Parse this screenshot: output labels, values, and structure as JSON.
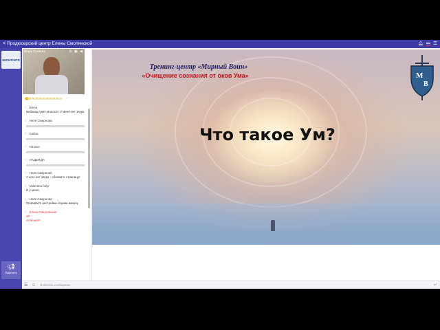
{
  "titlebar": {
    "title": "Продюсерский центр Елены Смолянской"
  },
  "sidebar": {
    "logo_text": "ВКОНТАКТЕ",
    "share_label": "Поделить"
  },
  "video": {
    "presenter_name": "Игорь Ружанко",
    "controls": "⊡ ▣ ◀"
  },
  "chat": {
    "emoji_line": "😊!!!!!!!!!!!!!!!!!!!!!!!!!!!!!!!!!!!!!!!",
    "messages": [
      {
        "author": "Elena",
        "text": "Вебинар уже начался? У меня нет звука",
        "bar": false
      },
      {
        "author": "Неля Смирнова",
        "text": "",
        "bar": true
      },
      {
        "author": "Galina",
        "text": "",
        "bar": true
      },
      {
        "author": "Наталя",
        "text": "",
        "bar": true
      },
      {
        "author": "НАДЕЖДА",
        "text": "",
        "bar": true
      },
      {
        "author": "Неля Смирнова",
        "text": "У кого нет звука - обновите страницу!",
        "bar": false
      },
      {
        "author": "Valentina bolyr",
        "text": "И у меня",
        "bar": false
      },
      {
        "author": "Неля Смирнова",
        "text": "Проверьте настройки справа вверху",
        "bar": false
      },
      {
        "author": "Елена Смолянская",
        "text": "30",
        "text2": "отлично!!!",
        "bar": false,
        "highlight": true
      }
    ],
    "input_placeholder": "Написать сообщение"
  },
  "slide": {
    "org": "Тренинг-центр «Мирный Воин»",
    "course": "«Очищение сознания от оков Ума»",
    "question": "Что такое Ум?",
    "logo_letters": "M B"
  },
  "colors": {
    "accent": "#4845b0",
    "title_red": "#c0141b",
    "title_blue": "#1a1a60"
  }
}
